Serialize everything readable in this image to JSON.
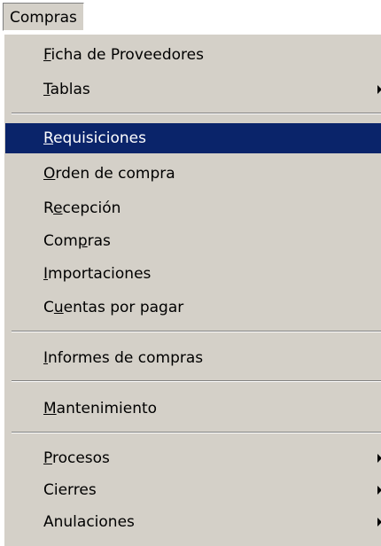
{
  "menubar": {
    "title": "Compras"
  },
  "menu": {
    "items": [
      {
        "label": "Ficha de Proveedores",
        "mnemonic": "F",
        "rest": "icha de Proveedores",
        "submenu": false
      },
      {
        "label": "Tablas",
        "mnemonic": "T",
        "rest": "ablas",
        "submenu": true
      },
      {
        "label": "Requisiciones",
        "mnemonic": "R",
        "rest": "equisiciones",
        "submenu": false,
        "selected": true
      },
      {
        "label": "Orden de compra",
        "mnemonic": "O",
        "rest": "rden de compra",
        "submenu": false
      },
      {
        "label": "Recepción",
        "pre": "R",
        "mnemonic": "e",
        "rest": "cepción",
        "submenu": false
      },
      {
        "label": "Compras",
        "pre": "Com",
        "mnemonic": "p",
        "rest": "ras",
        "submenu": false
      },
      {
        "label": "Importaciones",
        "mnemonic": "I",
        "rest": "mportaciones",
        "submenu": false
      },
      {
        "label": "Cuentas por pagar",
        "pre": "C",
        "mnemonic": "u",
        "rest": "entas por pagar",
        "submenu": false
      },
      {
        "label": "Informes de compras",
        "mnemonic": "I",
        "rest": "nformes de compras",
        "submenu": false
      },
      {
        "label": "Mantenimiento",
        "mnemonic": "M",
        "rest": "antenimiento",
        "submenu": false
      },
      {
        "label": "Procesos",
        "mnemonic": "P",
        "rest": "rocesos",
        "submenu": true
      },
      {
        "label": "Cierres",
        "mnemonic": "",
        "rest": "Cierres",
        "submenu": true
      },
      {
        "label": "Anulaciones",
        "mnemonic": "",
        "rest": "Anulaciones",
        "submenu": true
      }
    ]
  },
  "colors": {
    "menu_bg": "#d4d0c8",
    "selection_bg": "#0a246a",
    "selection_text": "#ffffff"
  }
}
